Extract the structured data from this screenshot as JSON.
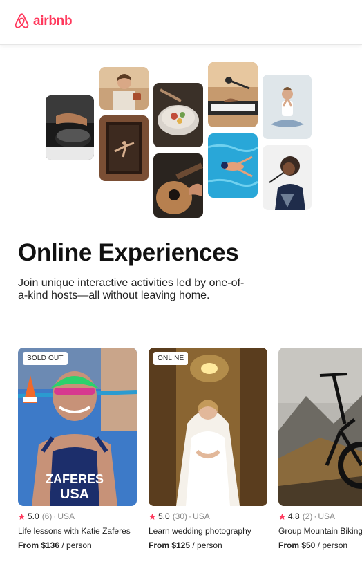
{
  "brand": {
    "name": "airbnb",
    "color": "#FF385C"
  },
  "hero": {
    "title": "Online Experiences",
    "subtitle": "Join unique interactive activities led by one-of-a-kind hosts—all without leaving home."
  },
  "collage": [
    {
      "subject": "cooking-pan"
    },
    {
      "subject": "woman-holding-tea"
    },
    {
      "subject": "dancer-in-doorway"
    },
    {
      "subject": "food-bowl"
    },
    {
      "subject": "guitar-player"
    },
    {
      "subject": "keyboard-musician"
    },
    {
      "subject": "swimmer"
    },
    {
      "subject": "yoga-meditation"
    },
    {
      "subject": "singer-with-microphone"
    }
  ],
  "cards": [
    {
      "badge": "SOLD OUT",
      "rating": "5.0",
      "reviews": "(6)",
      "location": "USA",
      "title": "Life lessons with Katie Zaferes",
      "price": "From $136",
      "unit": "/ person"
    },
    {
      "badge": "ONLINE",
      "rating": "5.0",
      "reviews": "(30)",
      "location": "USA",
      "title": "Learn wedding photography",
      "price": "From $125",
      "unit": "/ person"
    },
    {
      "badge": "",
      "rating": "4.8",
      "reviews": "(2)",
      "location": "USA",
      "title": "Group Mountain Biking",
      "price": "From $50",
      "unit": "/ person"
    }
  ],
  "separator": "·",
  "star_color": "#FF385C"
}
